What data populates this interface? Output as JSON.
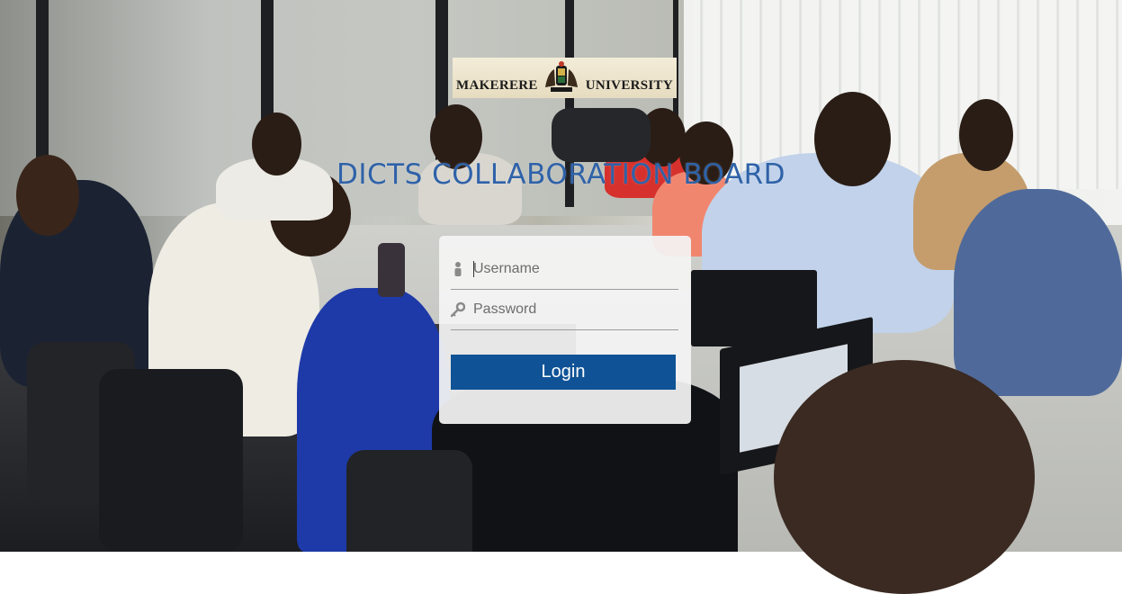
{
  "logo": {
    "left_text": "MAKERERE",
    "right_text": "UNIVERSITY",
    "crest_icon": "university-crest-icon"
  },
  "title": "DICTS COLLABORATION BOARD",
  "login_form": {
    "username": {
      "placeholder": "Username",
      "value": "",
      "icon": "user-icon"
    },
    "password": {
      "placeholder": "Password",
      "value": "",
      "icon": "key-icon"
    },
    "login_label": "Login"
  },
  "colors": {
    "title": "#2f62a8",
    "button": "#0f5396",
    "panel": "#f4f4f4"
  }
}
